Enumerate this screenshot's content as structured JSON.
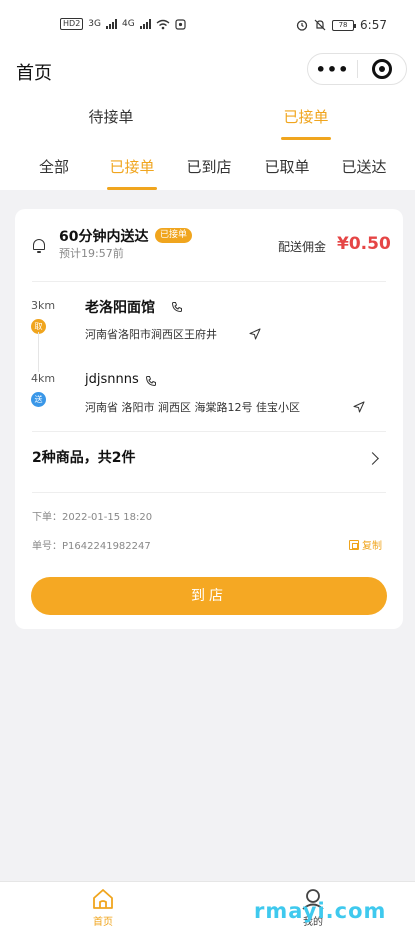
{
  "status_bar": {
    "hd_label": "HD",
    "sim_label": "2",
    "network_3g": "3G",
    "network_4g": "4G",
    "battery": "78",
    "time": "6:57"
  },
  "navbar": {
    "title": "首页",
    "more_label": "•••"
  },
  "top_tabs": [
    {
      "label": "待接单",
      "active": false
    },
    {
      "label": "已接单",
      "active": true
    }
  ],
  "sub_tabs": [
    {
      "label": "全部",
      "active": false
    },
    {
      "label": "已接单",
      "active": true
    },
    {
      "label": "已到店",
      "active": false
    },
    {
      "label": "已取单",
      "active": false
    },
    {
      "label": "已送达",
      "active": false
    }
  ],
  "order": {
    "deadline": "60分钟内送达",
    "status_badge": "已接单",
    "eta": "预计19:57前",
    "fee_label": "配送佣金",
    "fee_amount": "¥0.50",
    "pickup": {
      "distance": "3km",
      "pin_label": "取",
      "name": "老洛阳面馆",
      "address": "河南省洛阳市涧西区王府井"
    },
    "dropoff": {
      "distance": "4km",
      "pin_label": "送",
      "name": "jdjsnnns",
      "address": "河南省 洛阳市 涧西区 海棠路12号 佳宝小区"
    },
    "goods_summary": "2种商品，共2件",
    "order_time": "下单：2022-01-15  18:20",
    "order_number": "单号：P1642241982247",
    "copy_label": "复制",
    "action_button": "到店"
  },
  "tabbar": {
    "home_label": "首页",
    "mine_label": "我的"
  },
  "watermark": "rmayi.com",
  "colors": {
    "accent": "#f0a51e",
    "price": "#e54545",
    "pin_send": "#3a97e8",
    "background": "#f2f2f4"
  }
}
